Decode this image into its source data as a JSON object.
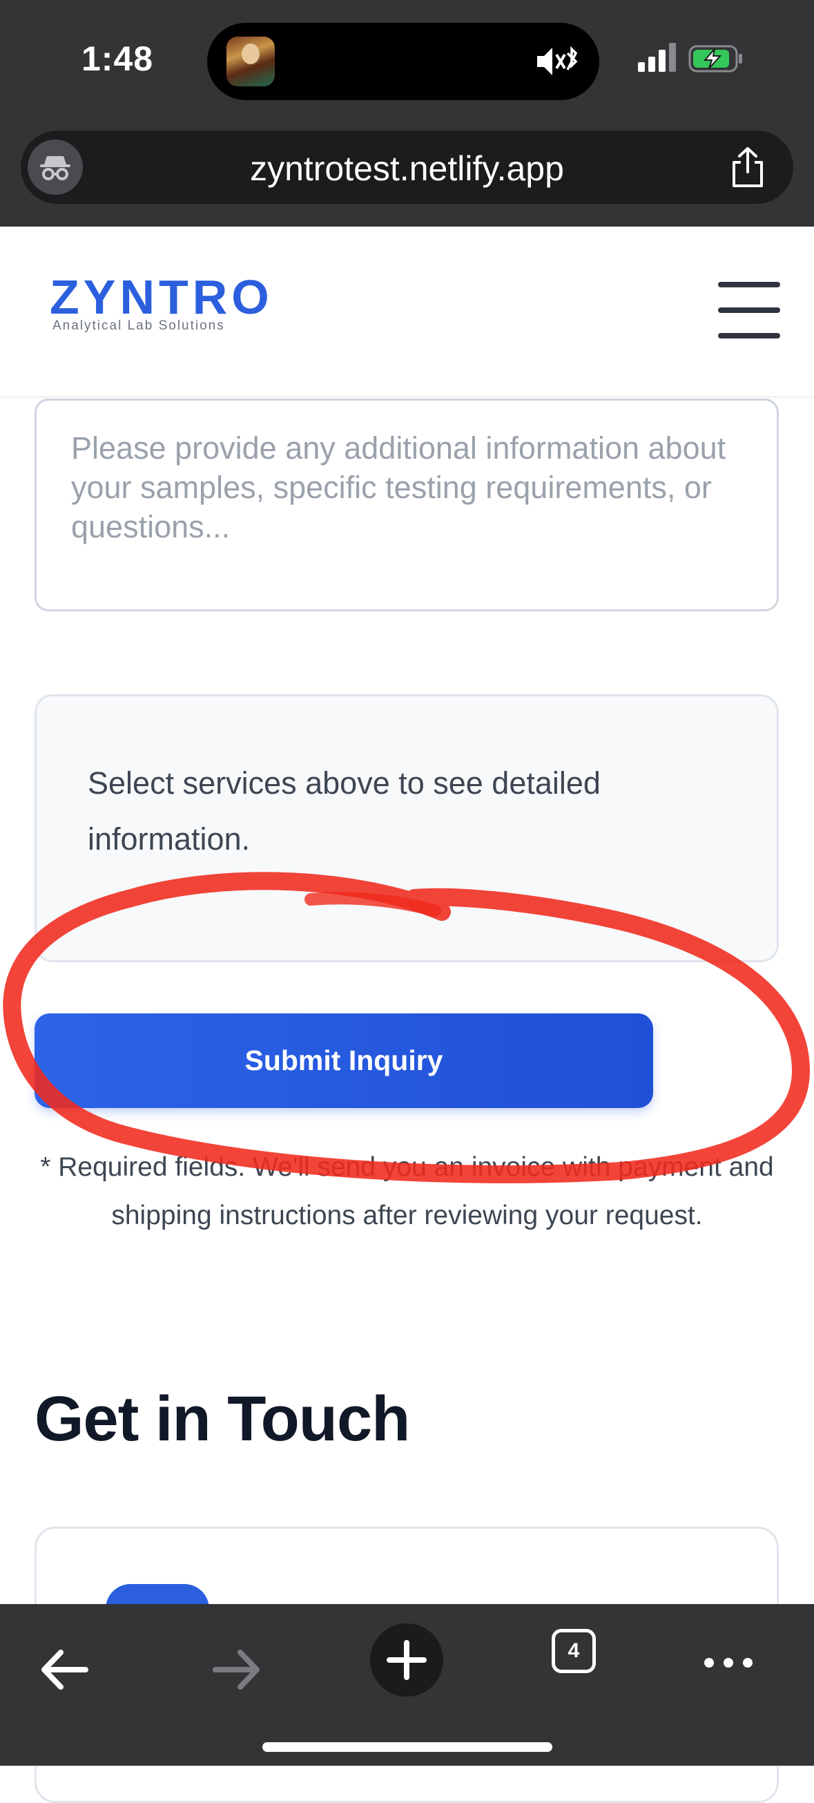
{
  "status_bar": {
    "time": "1:48"
  },
  "browser": {
    "url": "zyntrotest.netlify.app",
    "tab_count": "4"
  },
  "site": {
    "logo": "ZYNTRO",
    "tagline": "Analytical Lab Solutions"
  },
  "form": {
    "notes_placeholder": "Please provide any additional information about your samples, specific testing requirements, or questions...",
    "services_info": "Select services above to see detailed information.",
    "submit_label": "Submit Inquiry",
    "required_note": "* Required fields. We'll send you an invoice with payment and shipping instructions after reviewing your request."
  },
  "contact": {
    "heading": "Get in Touch"
  },
  "colors": {
    "brand_blue": "#2b5fde",
    "annotation_red": "#f02a1e",
    "browser_chrome": "#323436"
  },
  "icons": [
    "incognito-icon",
    "share-icon",
    "hamburger-menu-icon",
    "back-icon",
    "forward-icon",
    "new-tab-icon",
    "tabs-icon",
    "more-icon",
    "signal-icon",
    "battery-icon",
    "mute-icon",
    "bluetooth-icon"
  ]
}
